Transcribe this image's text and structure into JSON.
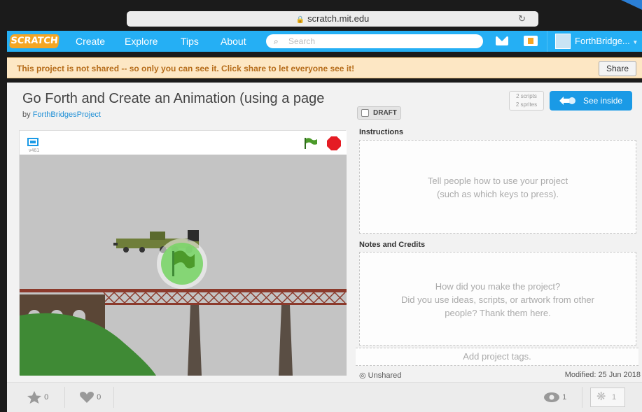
{
  "browser": {
    "url": "scratch.mit.edu"
  },
  "nav": {
    "logo": "SCRATCH",
    "items": [
      "Create",
      "Explore",
      "Tips",
      "About"
    ],
    "search_placeholder": "Search",
    "username": "ForthBridge..."
  },
  "notice": {
    "text": "This project is not shared -- so only you can see it. Click share to let everyone see it!",
    "share_label": "Share"
  },
  "project": {
    "title": "Go Forth and Create an Animation (using a page",
    "by": "by",
    "author": "ForthBridgesProject",
    "draft_label": "DRAFT",
    "scripts_count": "2 scripts",
    "sprites_count": "2 sprites",
    "see_inside_label": "See inside",
    "version": "v461"
  },
  "side": {
    "instructions_label": "Instructions",
    "instructions_placeholder_1": "Tell people how to use your project",
    "instructions_placeholder_2": "(such as which keys to press).",
    "notes_label": "Notes and Credits",
    "notes_placeholder_1": "How did you make the project?",
    "notes_placeholder_2": "Did you use ideas, scripts, or artwork from other",
    "notes_placeholder_3": "people? Thank them here.",
    "tags_placeholder": "Add project tags.",
    "status": "Unshared",
    "modified": "Modified: 25 Jun 2018"
  },
  "stats": {
    "favorites": "0",
    "loves": "0",
    "views": "1",
    "remixes": "1"
  },
  "colors": {
    "nav_blue": "#25aff4",
    "notice_bg": "#fde7c4",
    "notice_text": "#b66d1b",
    "see_inside_blue": "#1a9ae6",
    "green_flag": "#4c9a2a",
    "stop_red": "#e51c24"
  }
}
